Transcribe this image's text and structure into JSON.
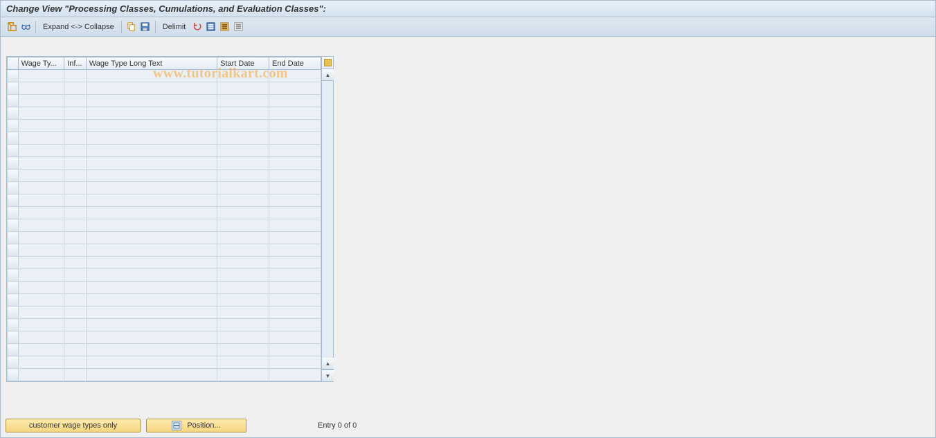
{
  "title": "Change View \"Processing Classes, Cumulations, and Evaluation Classes\":",
  "toolbar": {
    "expand_collapse": "Expand <-> Collapse",
    "delimit": "Delimit"
  },
  "table": {
    "columns": {
      "wage_type": "Wage Ty...",
      "inf": "Inf...",
      "long_text": "Wage Type Long Text",
      "start_date": "Start Date",
      "end_date": "End Date"
    },
    "row_count": 25
  },
  "footer": {
    "customer_btn": "customer wage types only",
    "position_btn": "Position...",
    "entry_text": "Entry 0 of 0"
  },
  "watermark": "www.tutorialkart.com"
}
